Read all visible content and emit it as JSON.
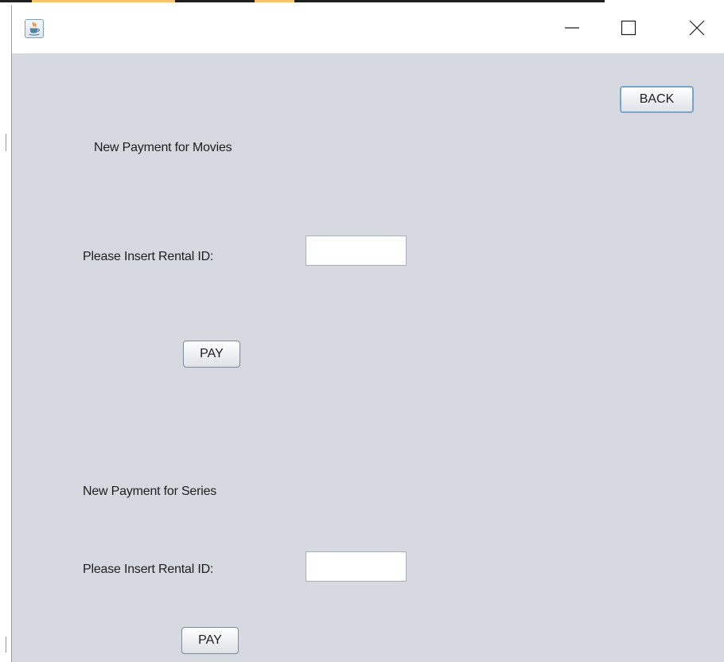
{
  "window": {
    "icon": "java-cup-icon",
    "controls": {
      "minimize_icon": "minimize-icon",
      "maximize_icon": "maximize-icon",
      "close_icon": "close-icon"
    }
  },
  "toolbar": {
    "back_label": "BACK"
  },
  "movies": {
    "heading": "New Payment for Movies",
    "rental_label": "Please Insert Rental ID:",
    "rental_value": "",
    "rental_placeholder": "",
    "pay_label": "PAY"
  },
  "series": {
    "heading": "New Payment for Series",
    "rental_label": "Please Insert Rental ID:",
    "rental_value": "",
    "rental_placeholder": "",
    "pay_label": "PAY"
  },
  "colors": {
    "panel_background": "#d6d9df",
    "titlebar_background": "#ffffff",
    "focus_border": "#7ba3cc"
  }
}
